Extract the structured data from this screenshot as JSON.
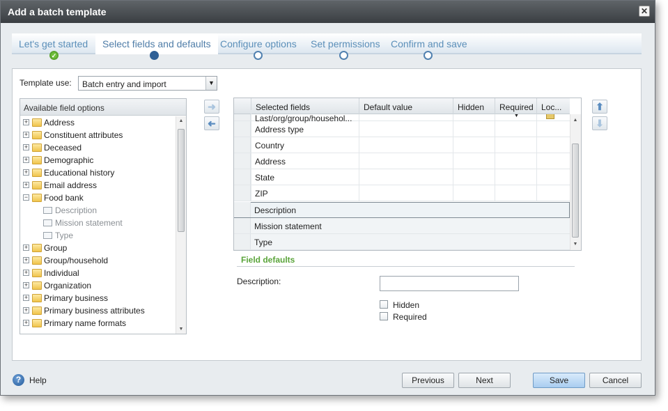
{
  "window": {
    "title": "Add a batch template",
    "close_glyph": "✕"
  },
  "wizard": {
    "steps": [
      {
        "label": "Let's get started",
        "state": "done"
      },
      {
        "label": "Select fields and defaults",
        "state": "current"
      },
      {
        "label": "Configure options",
        "state": "pending"
      },
      {
        "label": "Set permissions",
        "state": "pending"
      },
      {
        "label": "Confirm and save",
        "state": "pending"
      }
    ],
    "done_glyph": "✓"
  },
  "template_use": {
    "label": "Template use:",
    "value": "Batch entry and import"
  },
  "available": {
    "header": "Available field options",
    "items": [
      {
        "label": "Address",
        "type": "folder"
      },
      {
        "label": "Constituent attributes",
        "type": "folder"
      },
      {
        "label": "Deceased",
        "type": "folder"
      },
      {
        "label": "Demographic",
        "type": "folder"
      },
      {
        "label": "Educational history",
        "type": "folder"
      },
      {
        "label": "Email address",
        "type": "folder"
      },
      {
        "label": "Food bank",
        "type": "folder-open"
      },
      {
        "label": "Description",
        "type": "field"
      },
      {
        "label": "Mission statement",
        "type": "field"
      },
      {
        "label": "Type",
        "type": "field"
      },
      {
        "label": "Group",
        "type": "folder"
      },
      {
        "label": "Group/household",
        "type": "folder"
      },
      {
        "label": "Individual",
        "type": "folder"
      },
      {
        "label": "Organization",
        "type": "folder"
      },
      {
        "label": "Primary business",
        "type": "folder"
      },
      {
        "label": "Primary business attributes",
        "type": "folder"
      },
      {
        "label": "Primary name formats",
        "type": "folder"
      }
    ]
  },
  "selected": {
    "columns": [
      "Selected fields",
      "Default value",
      "Hidden",
      "Required",
      "Loc..."
    ],
    "rows": [
      {
        "field": "Last/org/group/househol..."
      },
      {
        "field": "Address type"
      },
      {
        "field": "Country"
      },
      {
        "field": "Address"
      },
      {
        "field": "State"
      },
      {
        "field": "ZIP"
      },
      {
        "field": "Description",
        "selected": true
      },
      {
        "field": "Mission statement"
      },
      {
        "field": "Type"
      }
    ]
  },
  "field_defaults": {
    "heading": "Field defaults",
    "description_label": "Description:",
    "description_value": "",
    "hidden_label": "Hidden",
    "required_label": "Required"
  },
  "footer": {
    "help": "Help",
    "previous": "Previous",
    "next": "Next",
    "save": "Save",
    "cancel": "Cancel"
  }
}
